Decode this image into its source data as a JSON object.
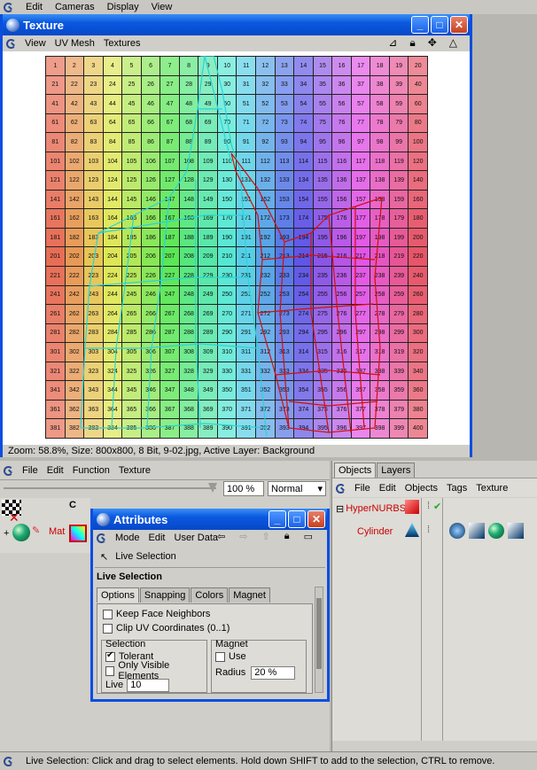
{
  "menubar": {
    "items": [
      "Edit",
      "Cameras",
      "Display",
      "View"
    ]
  },
  "texture_window": {
    "title": "Texture",
    "menu": [
      "View",
      "UV Mesh",
      "Textures"
    ],
    "status": "Zoom: 58.8%, Size: 800x800, 8 Bit, 9-02.jpg, Active Layer: Background"
  },
  "texture_panel": {
    "menu": [
      "File",
      "Edit",
      "Function",
      "Texture"
    ],
    "zoom_value": "100 %",
    "blend_mode": "Normal",
    "material_label": "Mat",
    "c_label": "C"
  },
  "attributes": {
    "title": "Attributes",
    "menu": [
      "Mode",
      "Edit",
      "User Data"
    ],
    "mode_label": "Live Selection",
    "heading": "Live Selection",
    "tabs": [
      "Options",
      "Snapping",
      "Colors",
      "Magnet"
    ],
    "keep_face_neighbors": "Keep Face Neighbors",
    "clip_uv": "Clip UV Coordinates (0..1)",
    "selection_group": "Selection",
    "tolerant": "Tolerant",
    "only_visible": "Only Visible Elements",
    "live_label": "Live",
    "live_value": "10",
    "magnet_group": "Magnet",
    "use_label": "Use",
    "radius_label": "Radius",
    "radius_value": "20 %"
  },
  "objects_panel": {
    "tabs": [
      "Objects",
      "Layers"
    ],
    "menu": [
      "File",
      "Edit",
      "Objects",
      "Tags",
      "Texture"
    ],
    "items": [
      {
        "name": "HyperNURBS",
        "color": "#cc0000"
      },
      {
        "name": "Cylinder",
        "color": "#cc0000"
      }
    ]
  },
  "status_bar": "Live Selection: Click and drag to select elements. Hold down SHIFT to add to the selection, CTRL to remove.",
  "colors": {
    "titlebar": "#0a58e0",
    "uv_cyan": "#2ad4d4",
    "uv_red": "#d01010"
  }
}
